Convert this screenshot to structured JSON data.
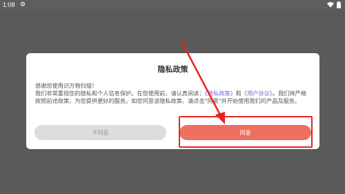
{
  "status_bar": {
    "time": "1:08",
    "icons": [
      "gear-icon",
      "wifi-icon",
      "battery-icon"
    ]
  },
  "dialog": {
    "title": "隐私政策",
    "body": {
      "greeting": "感谢您使用识万物扫描！",
      "line_a": "我们非常重视您的隐私和个人信息保护。在您使用前，请认真阅读：",
      "privacy_link": "《隐私政策》",
      "and": "和",
      "user_link": "《用户协议》",
      "line_b": "。我们将严格按照前述政策，为您提供更好的服务。如您同意该隐私政策，请点击\"同意\"并开始使用我们的产品及服务。"
    },
    "disagree_label": "不同意",
    "agree_label": "同意"
  },
  "colors": {
    "agree": "#ee7060",
    "link": "#7b6bd6",
    "annotation": "#e8231c"
  }
}
